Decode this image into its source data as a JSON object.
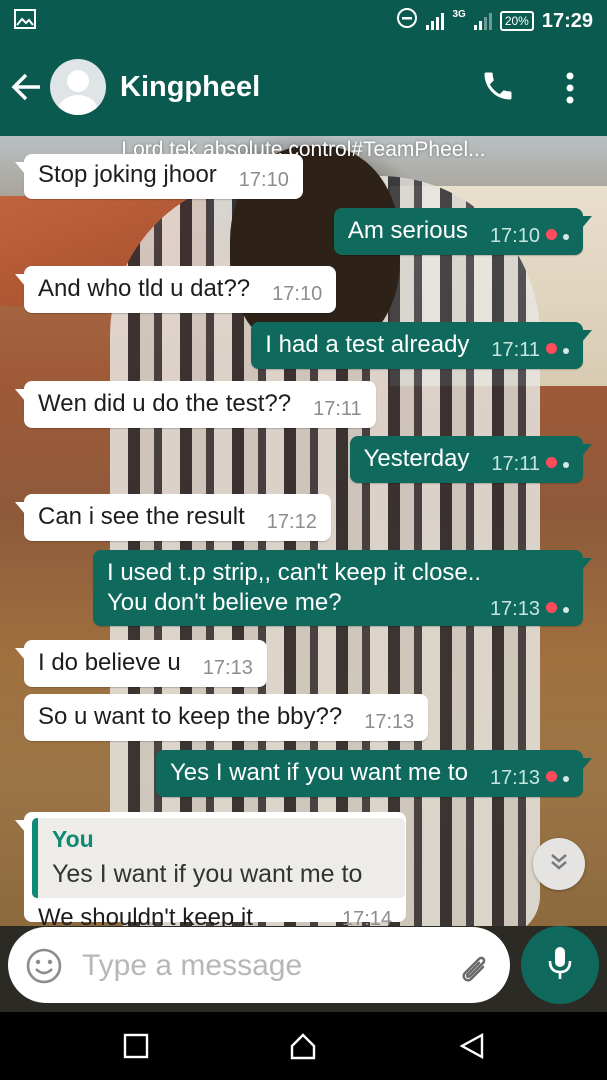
{
  "status_bar": {
    "network": "3G",
    "battery": "20%",
    "time": "17:29",
    "icons": [
      "gallery-icon",
      "do-not-disturb-icon",
      "signal-icon",
      "battery-icon"
    ]
  },
  "header": {
    "contact_name": "Kingpheel",
    "icons": [
      "back-arrow-icon",
      "avatar",
      "call-icon",
      "menu-icon"
    ]
  },
  "chat": {
    "banner": "Lord tek absolute control#TeamPheel...",
    "messages": [
      {
        "dir": "in",
        "text": "Stop joking jhoor",
        "time": "17:10"
      },
      {
        "dir": "out",
        "text": "Am serious",
        "time": "17:10"
      },
      {
        "dir": "in",
        "text": "And who tld u dat??",
        "time": "17:10"
      },
      {
        "dir": "out",
        "text": "I had a test already",
        "time": "17:11"
      },
      {
        "dir": "in",
        "text": "Wen did u do the test??",
        "time": "17:11"
      },
      {
        "dir": "out",
        "text": "Yesterday",
        "time": "17:11"
      },
      {
        "dir": "in",
        "text": "Can i see the result",
        "time": "17:12"
      },
      {
        "dir": "out",
        "text_line1": "I used t.p strip,, can't keep it close..",
        "text_line2": "You don't believe me?",
        "time": "17:13"
      },
      {
        "dir": "in",
        "text": "I do believe u",
        "time": "17:13"
      },
      {
        "dir": "in",
        "text": "So u want to keep the bby??",
        "time": "17:13"
      },
      {
        "dir": "out",
        "text": "Yes I want if you want me to",
        "time": "17:13"
      }
    ],
    "reply": {
      "quote_author": "You",
      "quote_text": "Yes I want if you want me to",
      "text": "We shouldn't keep it",
      "time": "17:14"
    }
  },
  "input": {
    "placeholder": "Type a message",
    "icons": [
      "emoji-icon",
      "attach-icon",
      "mic-icon"
    ]
  },
  "colors": {
    "header": "#0b5a4f",
    "outgoing_bubble": "#0f6a5d",
    "incoming_bubble": "#ffffff",
    "accent": "#0f8a74",
    "unread_dot": "#ff4b5c"
  }
}
